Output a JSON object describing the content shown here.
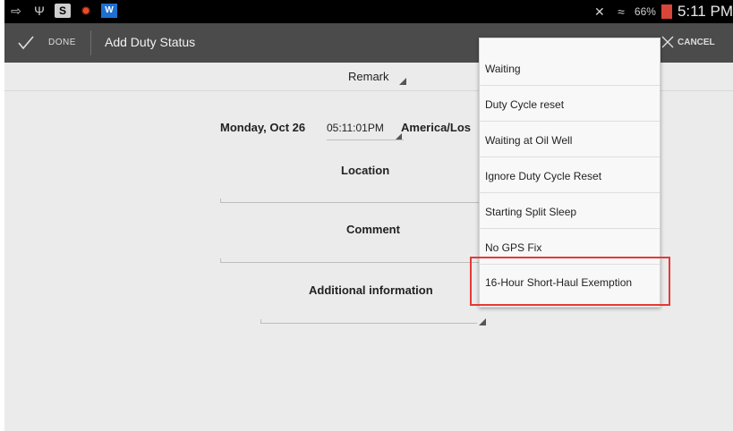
{
  "status_bar": {
    "left_icons": [
      "cast-icon",
      "usb-icon",
      "app-s-icon",
      "alert-icon",
      "word-icon"
    ],
    "battery": "66%",
    "time": "5:11 PM"
  },
  "action_bar": {
    "done_label": "DONE",
    "title": "Add Duty Status",
    "cancel_label": "CANCEL"
  },
  "form": {
    "status_value": "Remark",
    "date": "Monday, Oct 26",
    "time": "05:11:01PM",
    "timezone": "America/Los",
    "location_label": "Location",
    "comment_label": "Comment",
    "additional_label": "Additional information"
  },
  "menu": {
    "items": [
      {
        "label": "Waiting"
      },
      {
        "label": "Duty Cycle reset"
      },
      {
        "label": "Waiting at Oil Well"
      },
      {
        "label": "Ignore Duty Cycle Reset"
      },
      {
        "label": "Starting Split Sleep"
      },
      {
        "label": "No GPS Fix"
      },
      {
        "label": "16-Hour Short-Haul Exemption"
      }
    ],
    "highlighted_index": 6
  },
  "colors": {
    "action_bar": "#4b4b4b",
    "highlight": "#e53935",
    "background": "#ebebeb"
  }
}
